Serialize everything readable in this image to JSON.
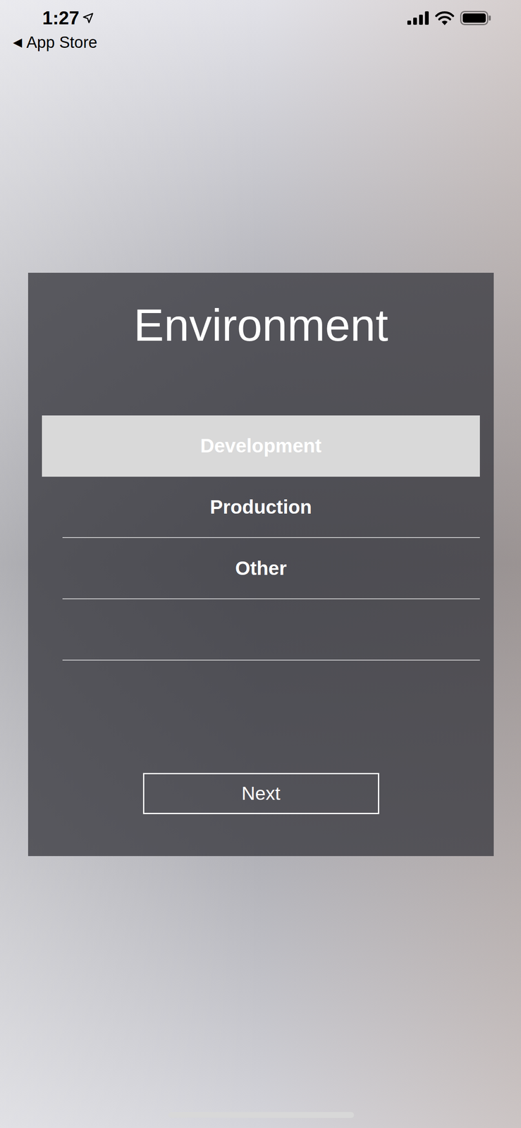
{
  "status_bar": {
    "time": "1:27",
    "back_arrow": "◀",
    "back_label": "App Store"
  },
  "panel": {
    "title": "Environment",
    "options": [
      {
        "label": "Development",
        "selected": true
      },
      {
        "label": "Production",
        "selected": false
      },
      {
        "label": "Other",
        "selected": false
      }
    ],
    "button": "Next"
  }
}
